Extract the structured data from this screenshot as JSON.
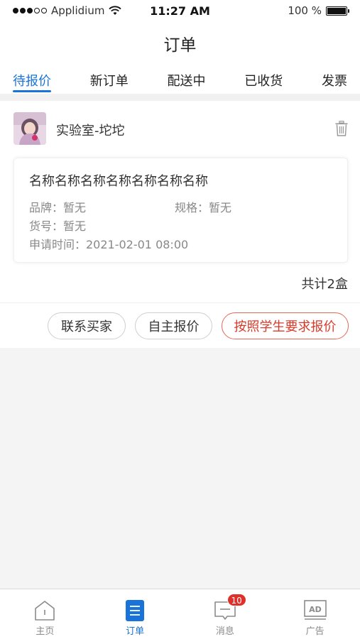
{
  "status_bar": {
    "carrier": "Applidium",
    "time": "11:27 AM",
    "battery": "100 %",
    "signal_bars_filled": 3,
    "signal_bars_total": 5
  },
  "nav": {
    "title": "订单"
  },
  "tabs": [
    {
      "label": "待报价",
      "active": true
    },
    {
      "label": "新订单"
    },
    {
      "label": "配送中"
    },
    {
      "label": "已收货"
    },
    {
      "label": "发票"
    }
  ],
  "order": {
    "lab_name": "实验室-坨坨",
    "product_name": "名称名称名称名称名称名称名称",
    "brand": "品牌：暂无",
    "spec": "规格：暂无",
    "code": "货号：暂无",
    "apply_time": "申请时间：2021-02-01 08:00",
    "total": "共计2盒",
    "buttons": {
      "contact": "联系买家",
      "self_quote": "自主报价",
      "student_quote": "按照学生要求报价"
    }
  },
  "tabbar": {
    "items": [
      {
        "label": "主页",
        "icon": "home-icon"
      },
      {
        "label": "订单",
        "icon": "order-icon",
        "active": true
      },
      {
        "label": "消息",
        "icon": "message-icon",
        "badge": "10"
      },
      {
        "label": "广告",
        "icon": "ad-icon"
      }
    ]
  },
  "colors": {
    "accent": "#1a73d9",
    "danger": "#d83a2a",
    "badge": "#e0302a"
  }
}
